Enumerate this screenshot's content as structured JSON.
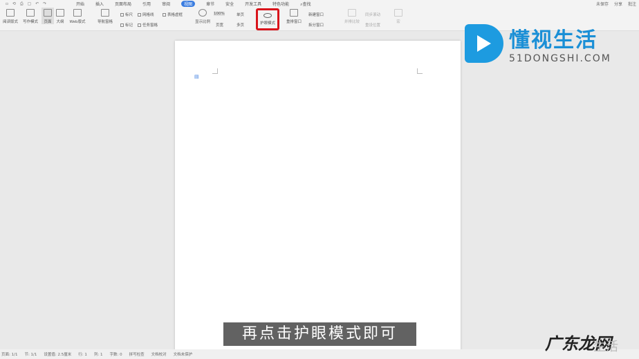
{
  "tabs": [
    "开始",
    "插入",
    "页面布局",
    "引用",
    "审阅",
    "视图",
    "章节",
    "安全",
    "开发工具",
    "特色功能",
    "查找"
  ],
  "active_tab": "视图",
  "top_right": [
    "未保存",
    "分享",
    "批注"
  ],
  "ribbon": {
    "read_mode": "阅读版式",
    "write_mode": "写作模式",
    "page": "页面",
    "outline": "大纲",
    "web": "Web版式",
    "nav": "导航窗格",
    "ruler": "标尺",
    "grid": "网格线",
    "table_frame": "表格虚框",
    "mark": "标记",
    "task_pane": "任务窗格",
    "zoom": "显示比例",
    "zoom_value": "100%",
    "single": "单页",
    "page_width": "页宽",
    "multi": "多页",
    "eye_mode": "护眼模式",
    "rearrange": "重排窗口",
    "new_window": "新建窗口",
    "split": "拆分窗口",
    "compare": "并排比较",
    "sync": "同步滚动",
    "reset": "重设位置",
    "macro": "宏"
  },
  "logo": {
    "cn": "懂视生活",
    "en": "51DONGSHI.COM"
  },
  "subtitle": "再点击护眼模式即可",
  "status": [
    "页面: 1/1",
    "节: 1/1",
    "设置值: 2.5厘米",
    "行: 1",
    "列: 1",
    "字数: 0",
    "拼写检查",
    "文档校对",
    "文档未保护"
  ],
  "watermark": {
    "main": "广东龙网",
    "side": "生活"
  },
  "colors": {
    "accent": "#3b7de0",
    "highlight": "#d9141b",
    "logo": "#1d9be0"
  }
}
